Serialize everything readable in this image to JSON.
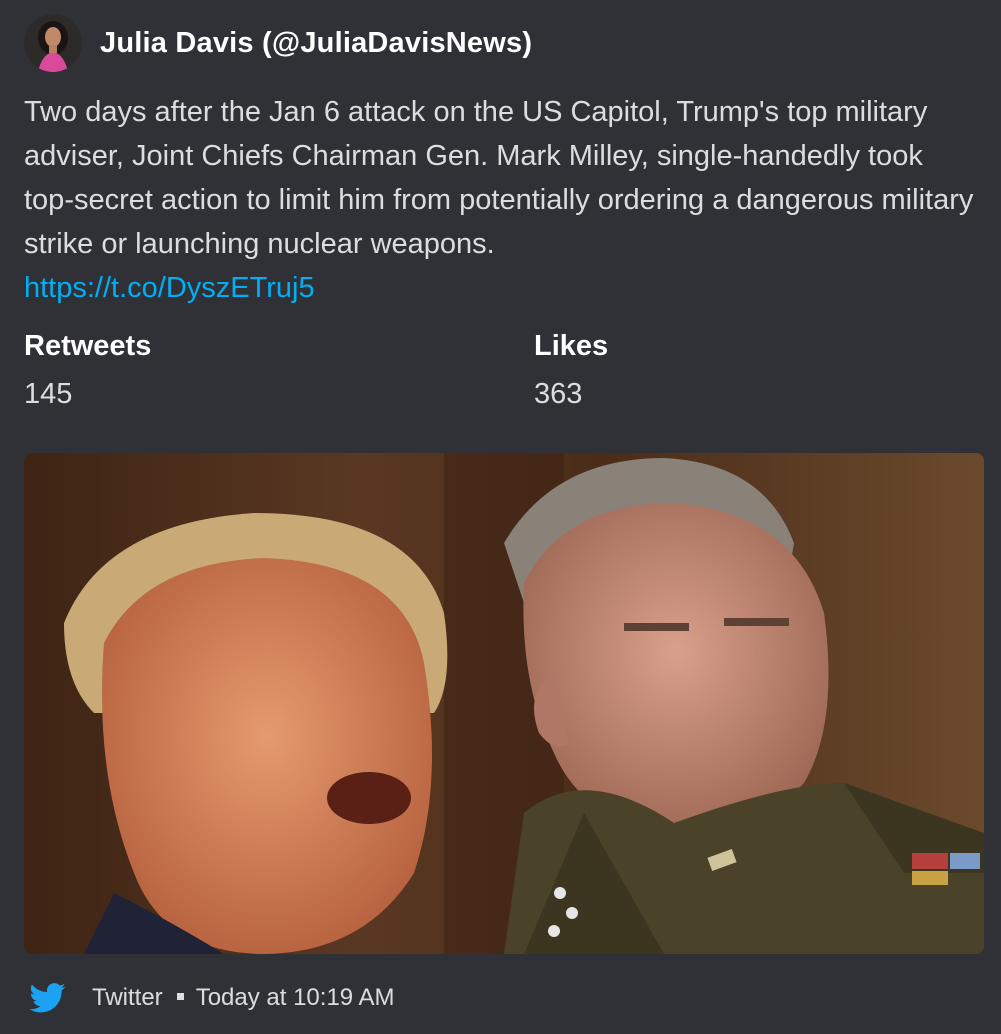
{
  "author": {
    "name": "Julia Davis (@JuliaDavisNews)"
  },
  "description": {
    "text": "Two days after the Jan 6 attack on the US Capitol, Trump's top military adviser, Joint Chiefs Chairman Gen. Mark Milley, single-handedly took top-secret action to limit him from potentially ordering a dangerous military strike or launching nuclear weapons.",
    "link": "https://t.co/DyszETruj5"
  },
  "fields": [
    {
      "name": "Retweets",
      "value": "145"
    },
    {
      "name": "Likes",
      "value": "363"
    }
  ],
  "footer": {
    "source": "Twitter",
    "timestamp": "Today at 10:19 AM",
    "icon": "twitter-bird-icon"
  },
  "colors": {
    "background": "#2f3136",
    "link": "#00aff4",
    "twitter_blue": "#1da1f2",
    "text": "#dcddde"
  },
  "media": {
    "description": "Photo of Donald Trump and Gen. Mark Milley"
  }
}
